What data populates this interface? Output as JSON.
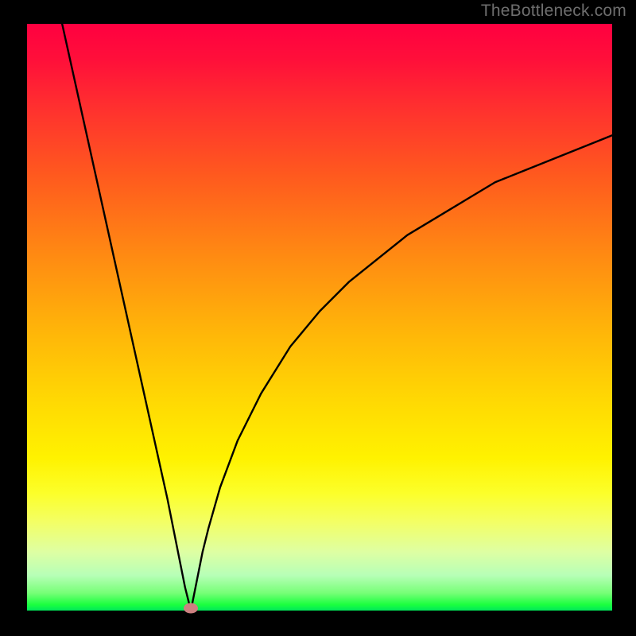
{
  "watermark": "TheBottleneck.com",
  "colors": {
    "background": "#000000",
    "curve": "#000000",
    "marker": "#cd8181",
    "gradient_top": "#ff0040",
    "gradient_bottom": "#00e85a"
  },
  "chart_data": {
    "type": "line",
    "title": "",
    "xlabel": "",
    "ylabel": "",
    "xlim": [
      0,
      100
    ],
    "ylim": [
      0,
      100
    ],
    "annotations": [],
    "legend": false,
    "grid": false,
    "background": "red-yellow-green vertical gradient (high=red, low=green)",
    "series": [
      {
        "name": "bottleneck-curve",
        "comment": "V-shaped curve; minimum near x≈28 y≈0; left branch rises steeply to y≈100 at x≈6; right branch rises with decreasing slope to y≈81 at x=100",
        "x": [
          6,
          8,
          10,
          12,
          14,
          16,
          18,
          20,
          22,
          24,
          26,
          27,
          28,
          29,
          30,
          31,
          33,
          36,
          40,
          45,
          50,
          55,
          60,
          65,
          70,
          75,
          80,
          85,
          90,
          95,
          100
        ],
        "y": [
          100,
          91,
          82,
          73,
          64,
          55,
          46,
          37,
          28,
          19,
          9,
          4,
          0,
          5,
          10,
          14,
          21,
          29,
          37,
          45,
          51,
          56,
          60,
          64,
          67,
          70,
          73,
          75,
          77,
          79,
          81
        ]
      }
    ],
    "marker": {
      "x": 28,
      "y": 0,
      "shape": "ellipse",
      "color": "#cd8181"
    }
  }
}
